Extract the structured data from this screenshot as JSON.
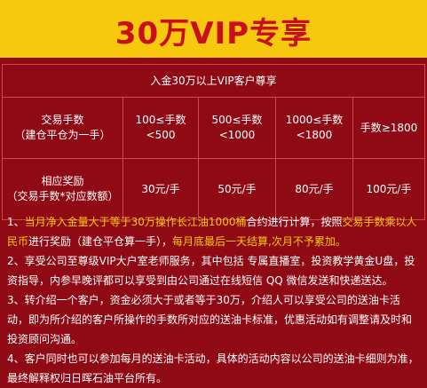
{
  "title": "30万VIP专享",
  "table": {
    "header": "入金30万以上VIP客户尊享",
    "row1": {
      "label_line1": "交易手数",
      "label_line2": "（建仓平仓为一手）",
      "cells": [
        {
          "line1": "100≤手数",
          "line2": "<500"
        },
        {
          "line1": "500≤手数",
          "line2": "<1000"
        },
        {
          "line1": "1000≤手数",
          "line2": "<1800"
        },
        {
          "line1": "手数≥1800",
          "line2": ""
        }
      ]
    },
    "row2": {
      "label_line1": "相应奖励",
      "label_line2": "（交易手数*对应数额）",
      "cells": [
        "30元/手",
        "50元/手",
        "80元/手",
        "100元/手"
      ]
    }
  },
  "notes": {
    "n1": {
      "a": "1、",
      "b": "当月净入金量大于等于30万操作",
      "c": "长江油1000桶",
      "d": "合约进行计算，按照",
      "e": "交易手数乘以人民币",
      "f": "进行奖励（建仓平仓算一手），",
      "g": "每月底最后一天结算,次月不予累加。"
    },
    "n2": "2、享受公司至尊级VIP大户室老师服务，其中包括 专属直播室，投资教学黄金U盘，投资指导，内参早晚评都可以享受到由公司通过在线短信 QQ 微信发送和快递送达。",
    "n3": "3、转介绍一个客户，资金必须大于或者等于30万，介绍人可以享受公司的送油卡活动，即为所介绍的客户所操作的手数所对应的送油卡标准，优惠活动如有调整请及时和投资顾问沟通。",
    "n4": "4、客户同时也可以参加每月的送油卡活动，具体的活动内容以公司的送油卡细则为准，最终解释权归日晖石油平台所有。"
  }
}
